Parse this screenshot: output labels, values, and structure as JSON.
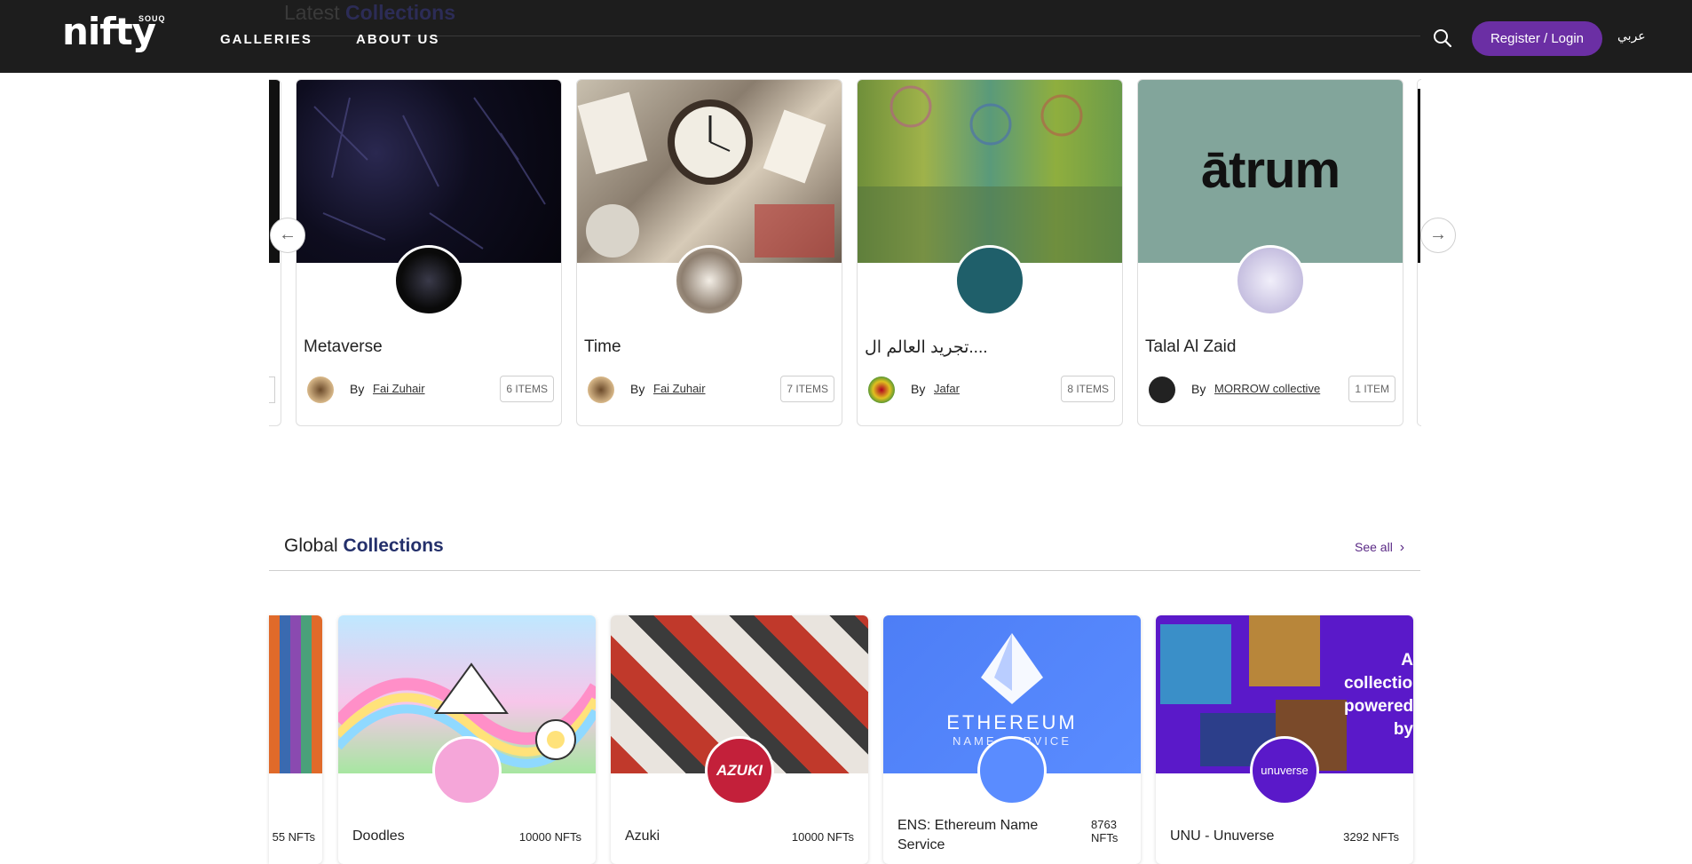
{
  "header": {
    "logo_text": "nifty",
    "logo_sub": "SOUQ",
    "nav": [
      "GALLERIES",
      "ABOUT US"
    ],
    "login_label": "Register / Login",
    "language_label": "عربي",
    "peek_title_regular": "Latest",
    "peek_title_bold": "Collections"
  },
  "latest": {
    "cards": [
      {
        "title": "Metaverse",
        "by_label": "By",
        "creator": "Fai Zuhair",
        "items": "6 ITEMS"
      },
      {
        "title": "Time",
        "by_label": "By",
        "creator": "Fai Zuhair",
        "items": "7 ITEMS"
      },
      {
        "title": "تجريد العالم ال....",
        "by_label": "By",
        "creator": "Jafar",
        "items": "8 ITEMS"
      },
      {
        "title": "Talal Al Zaid",
        "by_label": "By",
        "creator": "MORROW collective",
        "items": "1 ITEM",
        "cover_text": "ātrum"
      }
    ]
  },
  "global": {
    "title_regular": "Global",
    "title_bold": "Collections",
    "see_all": "See all",
    "partial_count": "55 NFTs",
    "cards": [
      {
        "name": "Doodles",
        "count": "10000 NFTs"
      },
      {
        "name": "Azuki",
        "count": "10000 NFTs",
        "logo_text": "AZUKI"
      },
      {
        "name": "ENS: Ethereum Name Service",
        "count": "8763 NFTs",
        "cover_line1": "ETHEREUM",
        "cover_line2": "NAME SERVICE"
      },
      {
        "name": "UNU - Unuverse",
        "count": "3292 NFTs",
        "logo_text": "unuverse",
        "cover_text": "A collection powered by"
      }
    ]
  },
  "colors": {
    "header_bg": "#1d1d1d",
    "accent_purple": "#6b2fa4",
    "title_navy": "#24306b",
    "see_all": "#5b2a86"
  }
}
